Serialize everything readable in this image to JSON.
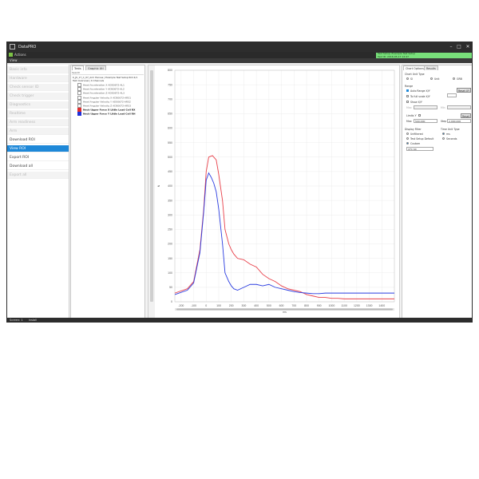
{
  "window": {
    "title": "DataPRO"
  },
  "ribbon": {
    "home_label": "Actions",
    "status_line1": "Test Setup: Example Test Setup",
    "status_line2": "Test ID: 2016-05-17 12:47"
  },
  "menubar": {
    "label": "View"
  },
  "sidebar": {
    "items": [
      {
        "label": "Basic info",
        "state": "dis"
      },
      {
        "label": "Hardware",
        "state": "dis"
      },
      {
        "label": "Check sensor ID",
        "state": "dis"
      },
      {
        "label": "Check trigger",
        "state": "dis"
      },
      {
        "label": "Diagnostics",
        "state": "dis"
      },
      {
        "label": "Realtime",
        "state": "dis"
      },
      {
        "label": "Arm readiness",
        "state": "dis"
      },
      {
        "label": "Arm",
        "state": "dis"
      },
      {
        "label": "Download ROI",
        "state": "en"
      },
      {
        "label": "View ROI",
        "state": "sel"
      },
      {
        "label": "Export ROI",
        "state": "en"
      },
      {
        "label": "Download all",
        "state": "en"
      },
      {
        "label": "Export all",
        "state": "dis"
      }
    ]
  },
  "channels_panel": {
    "tabs": [
      "Tests",
      "Graphic Utl"
    ],
    "search_label": "Search",
    "tree_line1": "K_JK_17_C_07_Arm Harnes | Example Test Setup ROI 4/1",
    "tree_line2": "Test Overview | 6 Channels",
    "channels": [
      {
        "label": "Head Acceleration X AD50672-AL1",
        "color": "",
        "checked": false
      },
      {
        "label": "Head Acceleration Y AD50672-AL2",
        "color": "",
        "checked": false
      },
      {
        "label": "Head Acceleration Z AD50672-AL3",
        "color": "",
        "checked": false
      },
      {
        "label": "Head Angular Velocity X AD50672-ARS1",
        "color": "",
        "checked": false
      },
      {
        "label": "Head Angular Velocity Y AD50672-ARS2",
        "color": "",
        "checked": false
      },
      {
        "label": "Head Angular Velocity Z AD50672-ARS3",
        "color": "",
        "checked": false
      },
      {
        "label": "Neck Upper Force X Little Load Cell RX",
        "color": "#e03030",
        "checked": true
      },
      {
        "label": "Neck Upper Force Y Little Load Cell RH",
        "color": "#2030d8",
        "checked": true
      }
    ]
  },
  "chart_data": {
    "type": "line",
    "title": "",
    "xlabel": "ms",
    "ylabel": "N",
    "xlim": [
      -250,
      1500
    ],
    "ylim": [
      0,
      800
    ],
    "x_ticks": [
      -200,
      -100,
      0,
      100,
      200,
      300,
      400,
      500,
      600,
      700,
      800,
      900,
      1000,
      1100,
      1200,
      1300,
      1400
    ],
    "y_ticks": [
      0,
      50,
      100,
      150,
      200,
      250,
      300,
      350,
      400,
      450,
      500,
      550,
      600,
      650,
      700,
      750,
      800
    ],
    "series": [
      {
        "name": "",
        "color": "#e8404a",
        "x": [
          -250,
          -150,
          -100,
          -50,
          -20,
          0,
          20,
          50,
          80,
          100,
          130,
          150,
          180,
          200,
          220,
          250,
          300,
          350,
          400,
          450,
          500,
          550,
          600,
          650,
          700,
          750,
          800,
          850,
          900,
          950,
          1000,
          1050,
          1100,
          1200,
          1300,
          1400,
          1500
        ],
        "y": [
          30,
          45,
          70,
          180,
          320,
          450,
          500,
          505,
          490,
          440,
          350,
          250,
          200,
          180,
          165,
          150,
          145,
          130,
          120,
          95,
          80,
          70,
          55,
          45,
          40,
          35,
          25,
          20,
          15,
          15,
          12,
          12,
          10,
          10,
          10,
          10,
          10
        ]
      },
      {
        "name": "",
        "color": "#2a3ce0",
        "x": [
          -250,
          -150,
          -100,
          -50,
          -20,
          0,
          20,
          40,
          60,
          80,
          100,
          130,
          150,
          180,
          200,
          220,
          250,
          300,
          350,
          400,
          450,
          500,
          550,
          600,
          650,
          700,
          750,
          800,
          850,
          900,
          950,
          1000,
          1100,
          1200,
          1300,
          1400,
          1500
        ],
        "y": [
          25,
          40,
          65,
          170,
          310,
          420,
          445,
          430,
          410,
          380,
          320,
          200,
          100,
          70,
          55,
          45,
          40,
          50,
          60,
          60,
          55,
          60,
          50,
          45,
          40,
          35,
          32,
          30,
          28,
          28,
          30,
          30,
          30,
          30,
          30,
          30,
          30
        ]
      }
    ],
    "grid": true,
    "legend": "none"
  },
  "right_panel": {
    "tabs": [
      "Chart Options",
      "Results"
    ],
    "chart_unit_type_label": "Chart Unit Type",
    "unit_options": [
      "SI",
      "Unit",
      "GRB"
    ],
    "range_label": "Range",
    "auto_range_label": "Auto Range X/Y",
    "reset_label": "Reset XY",
    "fit_label": "To full scale X/Y",
    "show_label": "Show X/Y",
    "max_label": "Max",
    "min_label": "Min",
    "limits_label": "Limits Y",
    "max_value": "500.000",
    "step_label": "Step",
    "step_value": "2.000.000",
    "reset2_label": "Reset",
    "display_filter_label": "Display Filter",
    "display_filter_options": [
      "Unfiltered",
      "Test Setup Default",
      "Custom"
    ],
    "filter_select": "CFC 60",
    "time_unit_label": "Time Unit Type",
    "time_units": [
      "ms",
      "Seconds"
    ]
  },
  "statusbar": {
    "left": "Screen: 1",
    "right": "Install"
  }
}
